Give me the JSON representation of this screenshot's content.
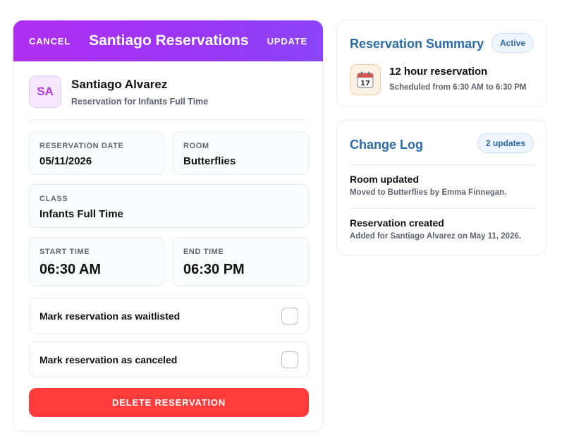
{
  "header": {
    "cancel_label": "CANCEL",
    "title": "Santiago Reservations",
    "update_label": "UPDATE"
  },
  "person": {
    "initials": "SA",
    "name": "Santiago Alvarez",
    "subtitle": "Reservation for Infants Full Time"
  },
  "fields": {
    "date_label": "RESERVATION DATE",
    "date_value": "05/11/2026",
    "room_label": "ROOM",
    "room_value": "Butterflies",
    "class_label": "CLASS",
    "class_value": "Infants Full Time",
    "start_label": "START TIME",
    "start_value": "06:30 AM",
    "end_label": "END TIME",
    "end_value": "06:30 PM"
  },
  "checks": {
    "waitlisted_label": "Mark reservation as waitlisted",
    "waitlisted_checked": false,
    "canceled_label": "Mark reservation as canceled",
    "canceled_checked": false
  },
  "delete_label": "DELETE RESERVATION",
  "summary": {
    "title": "Reservation Summary",
    "badge": "Active",
    "icon": "calendar-icon",
    "calendar_day": "17",
    "heading": "12 hour reservation",
    "detail": "Scheduled from 6:30 AM to 6:30 PM"
  },
  "change_log": {
    "title": "Change Log",
    "badge": "2 updates",
    "entries": [
      {
        "title": "Room updated",
        "detail": "Moved to Butterflies by Emma Finnegan."
      },
      {
        "title": "Reservation created",
        "detail": "Added for Santiago Alvarez on May 11, 2026."
      }
    ]
  },
  "colors": {
    "header_gradient_start": "#b02ff2",
    "header_gradient_end": "#8b45f8",
    "accent_blue": "#2b6aa8",
    "danger": "#ff3b3b",
    "avatar_text": "#b03be0"
  }
}
